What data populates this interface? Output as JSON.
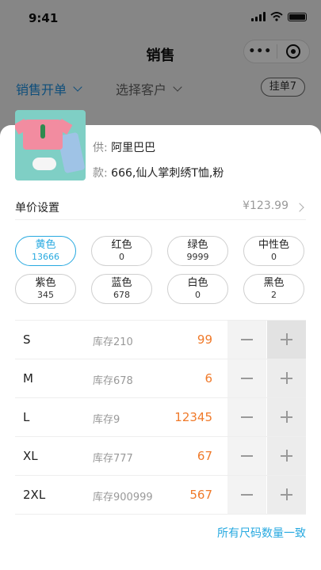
{
  "status_bar": {
    "time": "9:41"
  },
  "nav": {
    "title": "销售"
  },
  "tabs": {
    "sales_order": "销售开单",
    "select_customer": "选择客户",
    "pending": "挂单7"
  },
  "product": {
    "supplier_label": "供:",
    "supplier": "阿里巴巴",
    "style_label": "款:",
    "style": "666,仙人掌刺绣T恤,粉"
  },
  "price": {
    "label": "单价设置",
    "value": "¥123.99"
  },
  "colors": [
    {
      "name": "黄色",
      "qty": "13666",
      "selected": true
    },
    {
      "name": "红色",
      "qty": "0",
      "selected": false
    },
    {
      "name": "绿色",
      "qty": "9999",
      "selected": false
    },
    {
      "name": "中性色",
      "qty": "0",
      "selected": false
    },
    {
      "name": "紫色",
      "qty": "345",
      "selected": false
    },
    {
      "name": "蓝色",
      "qty": "678",
      "selected": false
    },
    {
      "name": "白色",
      "qty": "0",
      "selected": false
    },
    {
      "name": "黑色",
      "qty": "2",
      "selected": false
    }
  ],
  "sizes": [
    {
      "size": "S",
      "stock": "库存210",
      "qty": "99"
    },
    {
      "size": "M",
      "stock": "库存678",
      "qty": "6"
    },
    {
      "size": "L",
      "stock": "库存9",
      "qty": "12345"
    },
    {
      "size": "XL",
      "stock": "库存777",
      "qty": "67"
    },
    {
      "size": "2XL",
      "stock": "库存900999",
      "qty": "567"
    }
  ],
  "footer": {
    "uniform_link": "所有尺码数量一致"
  },
  "theme": {
    "accent": "#27a9e0",
    "qty_color": "#f07a2a",
    "tab_active": "#1a8fe0"
  }
}
